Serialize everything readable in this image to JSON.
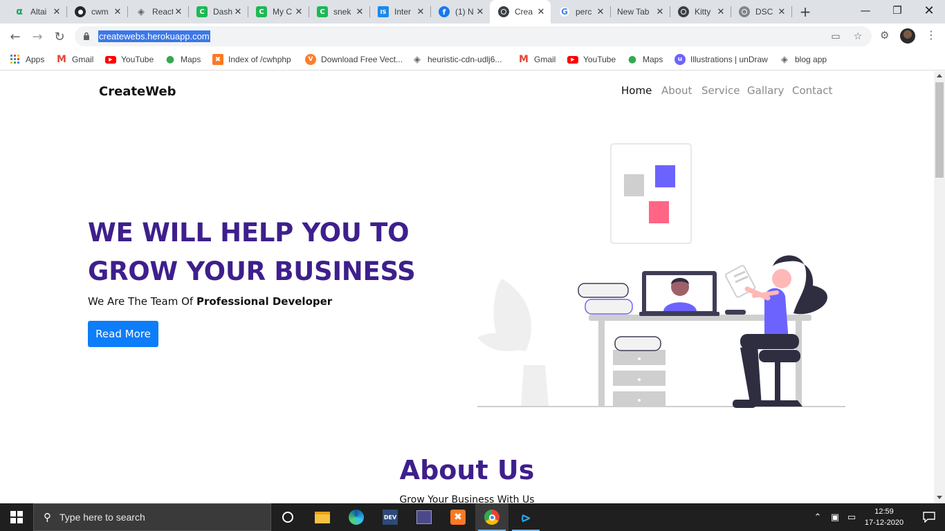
{
  "browser": {
    "tabs": [
      {
        "title": "Altai",
        "icon": "altair-icon",
        "color": "#1aa260",
        "glyph": "α"
      },
      {
        "title": "cwm",
        "icon": "github-icon",
        "color": "#24292e",
        "glyph": "●"
      },
      {
        "title": "React",
        "icon": "cube-icon",
        "color": "#5f6368",
        "glyph": "◈"
      },
      {
        "title": "Dash",
        "icon": "codechef-icon",
        "color": "#1db954",
        "glyph": "C"
      },
      {
        "title": "My C",
        "icon": "codechef-icon",
        "color": "#1db954",
        "glyph": "C"
      },
      {
        "title": "snek",
        "icon": "codechef-icon",
        "color": "#1db954",
        "glyph": "C"
      },
      {
        "title": "Inter",
        "icon": "is-icon",
        "color": "#1e88e5",
        "glyph": "IS"
      },
      {
        "title": "(1) N",
        "icon": "facebook-icon",
        "color": "#1877f2",
        "glyph": "f"
      },
      {
        "title": "Crea",
        "icon": "globe-icon",
        "color": "#3c4043",
        "glyph": "◎",
        "active": true
      },
      {
        "title": "perc",
        "icon": "google-icon",
        "color": "#4285f4",
        "glyph": "G"
      },
      {
        "title": "New Tab",
        "icon": "",
        "color": "#dee1e6",
        "glyph": ""
      },
      {
        "title": "Kitty",
        "icon": "globe-icon",
        "color": "#3c4043",
        "glyph": "◎"
      },
      {
        "title": "DSC",
        "icon": "globe-icon",
        "color": "#80868b",
        "glyph": "◎"
      }
    ],
    "url": "createwebs.herokuapp.com",
    "bookmarks": [
      {
        "label": "Apps",
        "icon": "apps-grid-icon"
      },
      {
        "label": "Gmail",
        "icon": "gmail-icon"
      },
      {
        "label": "YouTube",
        "icon": "youtube-icon"
      },
      {
        "label": "Maps",
        "icon": "maps-pin-icon"
      },
      {
        "label": "Index of /cwhphp",
        "icon": "xampp-icon"
      },
      {
        "label": "Download Free Vect...",
        "icon": "vecteezy-icon"
      },
      {
        "label": "heuristic-cdn-udlj6...",
        "icon": "cube-icon"
      },
      {
        "label": "Gmail",
        "icon": "gmail-icon"
      },
      {
        "label": "YouTube",
        "icon": "youtube-icon"
      },
      {
        "label": "Maps",
        "icon": "maps-pin-icon"
      },
      {
        "label": "Illustrations | unDraw",
        "icon": "undraw-icon"
      },
      {
        "label": "blog app",
        "icon": "cube-icon"
      }
    ]
  },
  "page": {
    "brand": "CreateWeb",
    "nav": [
      "Home",
      "About",
      "Service",
      "Gallary",
      "Contact"
    ],
    "hero": {
      "line1": "WE WILL HELP YOU TO",
      "line2": "GROW YOUR BUSINESS",
      "sub_prefix": "We Are The Team Of ",
      "sub_bold": "Professional Developer",
      "button": "Read More"
    },
    "about": {
      "title": "About Us",
      "subtitle": "Grow Your Business With Us"
    },
    "colors": {
      "heading": "#3e1f8c",
      "button": "#0d7dfa",
      "illustration_accent": "#6c63ff",
      "illustration_pink": "#ff6584"
    }
  },
  "taskbar": {
    "search_placeholder": "Type here to search",
    "time": "12:59",
    "date": "17-12-2020"
  }
}
